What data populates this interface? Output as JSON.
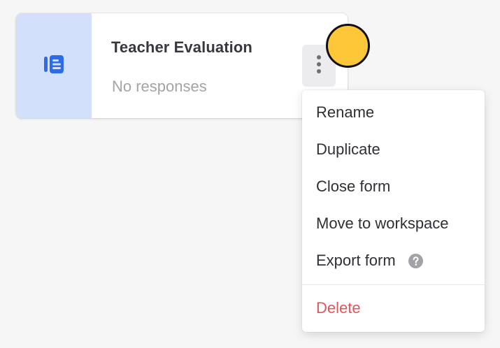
{
  "form_card": {
    "title": "Teacher Evaluation",
    "subtitle": "No responses",
    "thumb_icon": "form-document-icon",
    "thumb_bg": "#d2e0fb",
    "icon_color": "#2e6be6"
  },
  "more_button": {
    "icon": "vertical-ellipsis-icon"
  },
  "context_menu": {
    "items": [
      {
        "label": "Rename"
      },
      {
        "label": "Duplicate"
      },
      {
        "label": "Close form"
      },
      {
        "label": "Move to workspace"
      },
      {
        "label": "Export form",
        "icon": "help-circle-icon"
      },
      {
        "label": "Delete",
        "color": "#e0565a"
      }
    ]
  },
  "cursor_indicator": {
    "color": "#fdc737"
  }
}
